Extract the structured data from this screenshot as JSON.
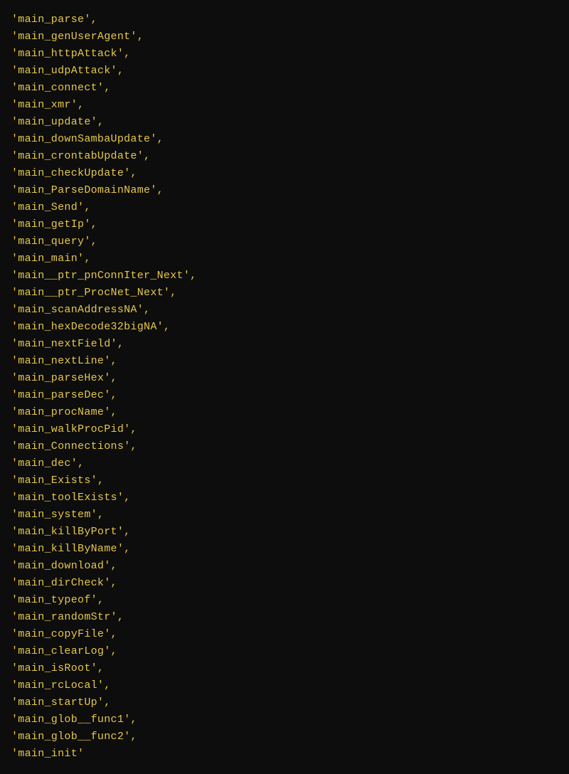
{
  "code": {
    "items": [
      "'main_parse',",
      "'main_genUserAgent',",
      "'main_httpAttack',",
      "'main_udpAttack',",
      "'main_connect',",
      "'main_xmr',",
      "'main_update',",
      "'main_downSambaUpdate',",
      "'main_crontabUpdate',",
      "'main_checkUpdate',",
      "'main_ParseDomainName',",
      "'main_Send',",
      "'main_getIp',",
      "'main_query',",
      "'main_main',",
      "'main__ptr_pnConnIter_Next',",
      "'main__ptr_ProcNet_Next',",
      "'main_scanAddressNA',",
      "'main_hexDecode32bigNA',",
      "'main_nextField',",
      "'main_nextLine',",
      "'main_parseHex',",
      "'main_parseDec',",
      "'main_procName',",
      "'main_walkProcPid',",
      "'main_Connections',",
      "'main_dec',",
      "'main_Exists',",
      "'main_toolExists',",
      "'main_system',",
      "'main_killByPort',",
      "'main_killByName',",
      "'main_download',",
      "'main_dirCheck',",
      "'main_typeof',",
      "'main_randomStr',",
      "'main_copyFile',",
      "'main_clearLog',",
      "'main_isRoot',",
      "'main_rcLocal',",
      "'main_startUp',",
      "'main_glob__func1',",
      "'main_glob__func2',",
      "'main_init'"
    ]
  }
}
